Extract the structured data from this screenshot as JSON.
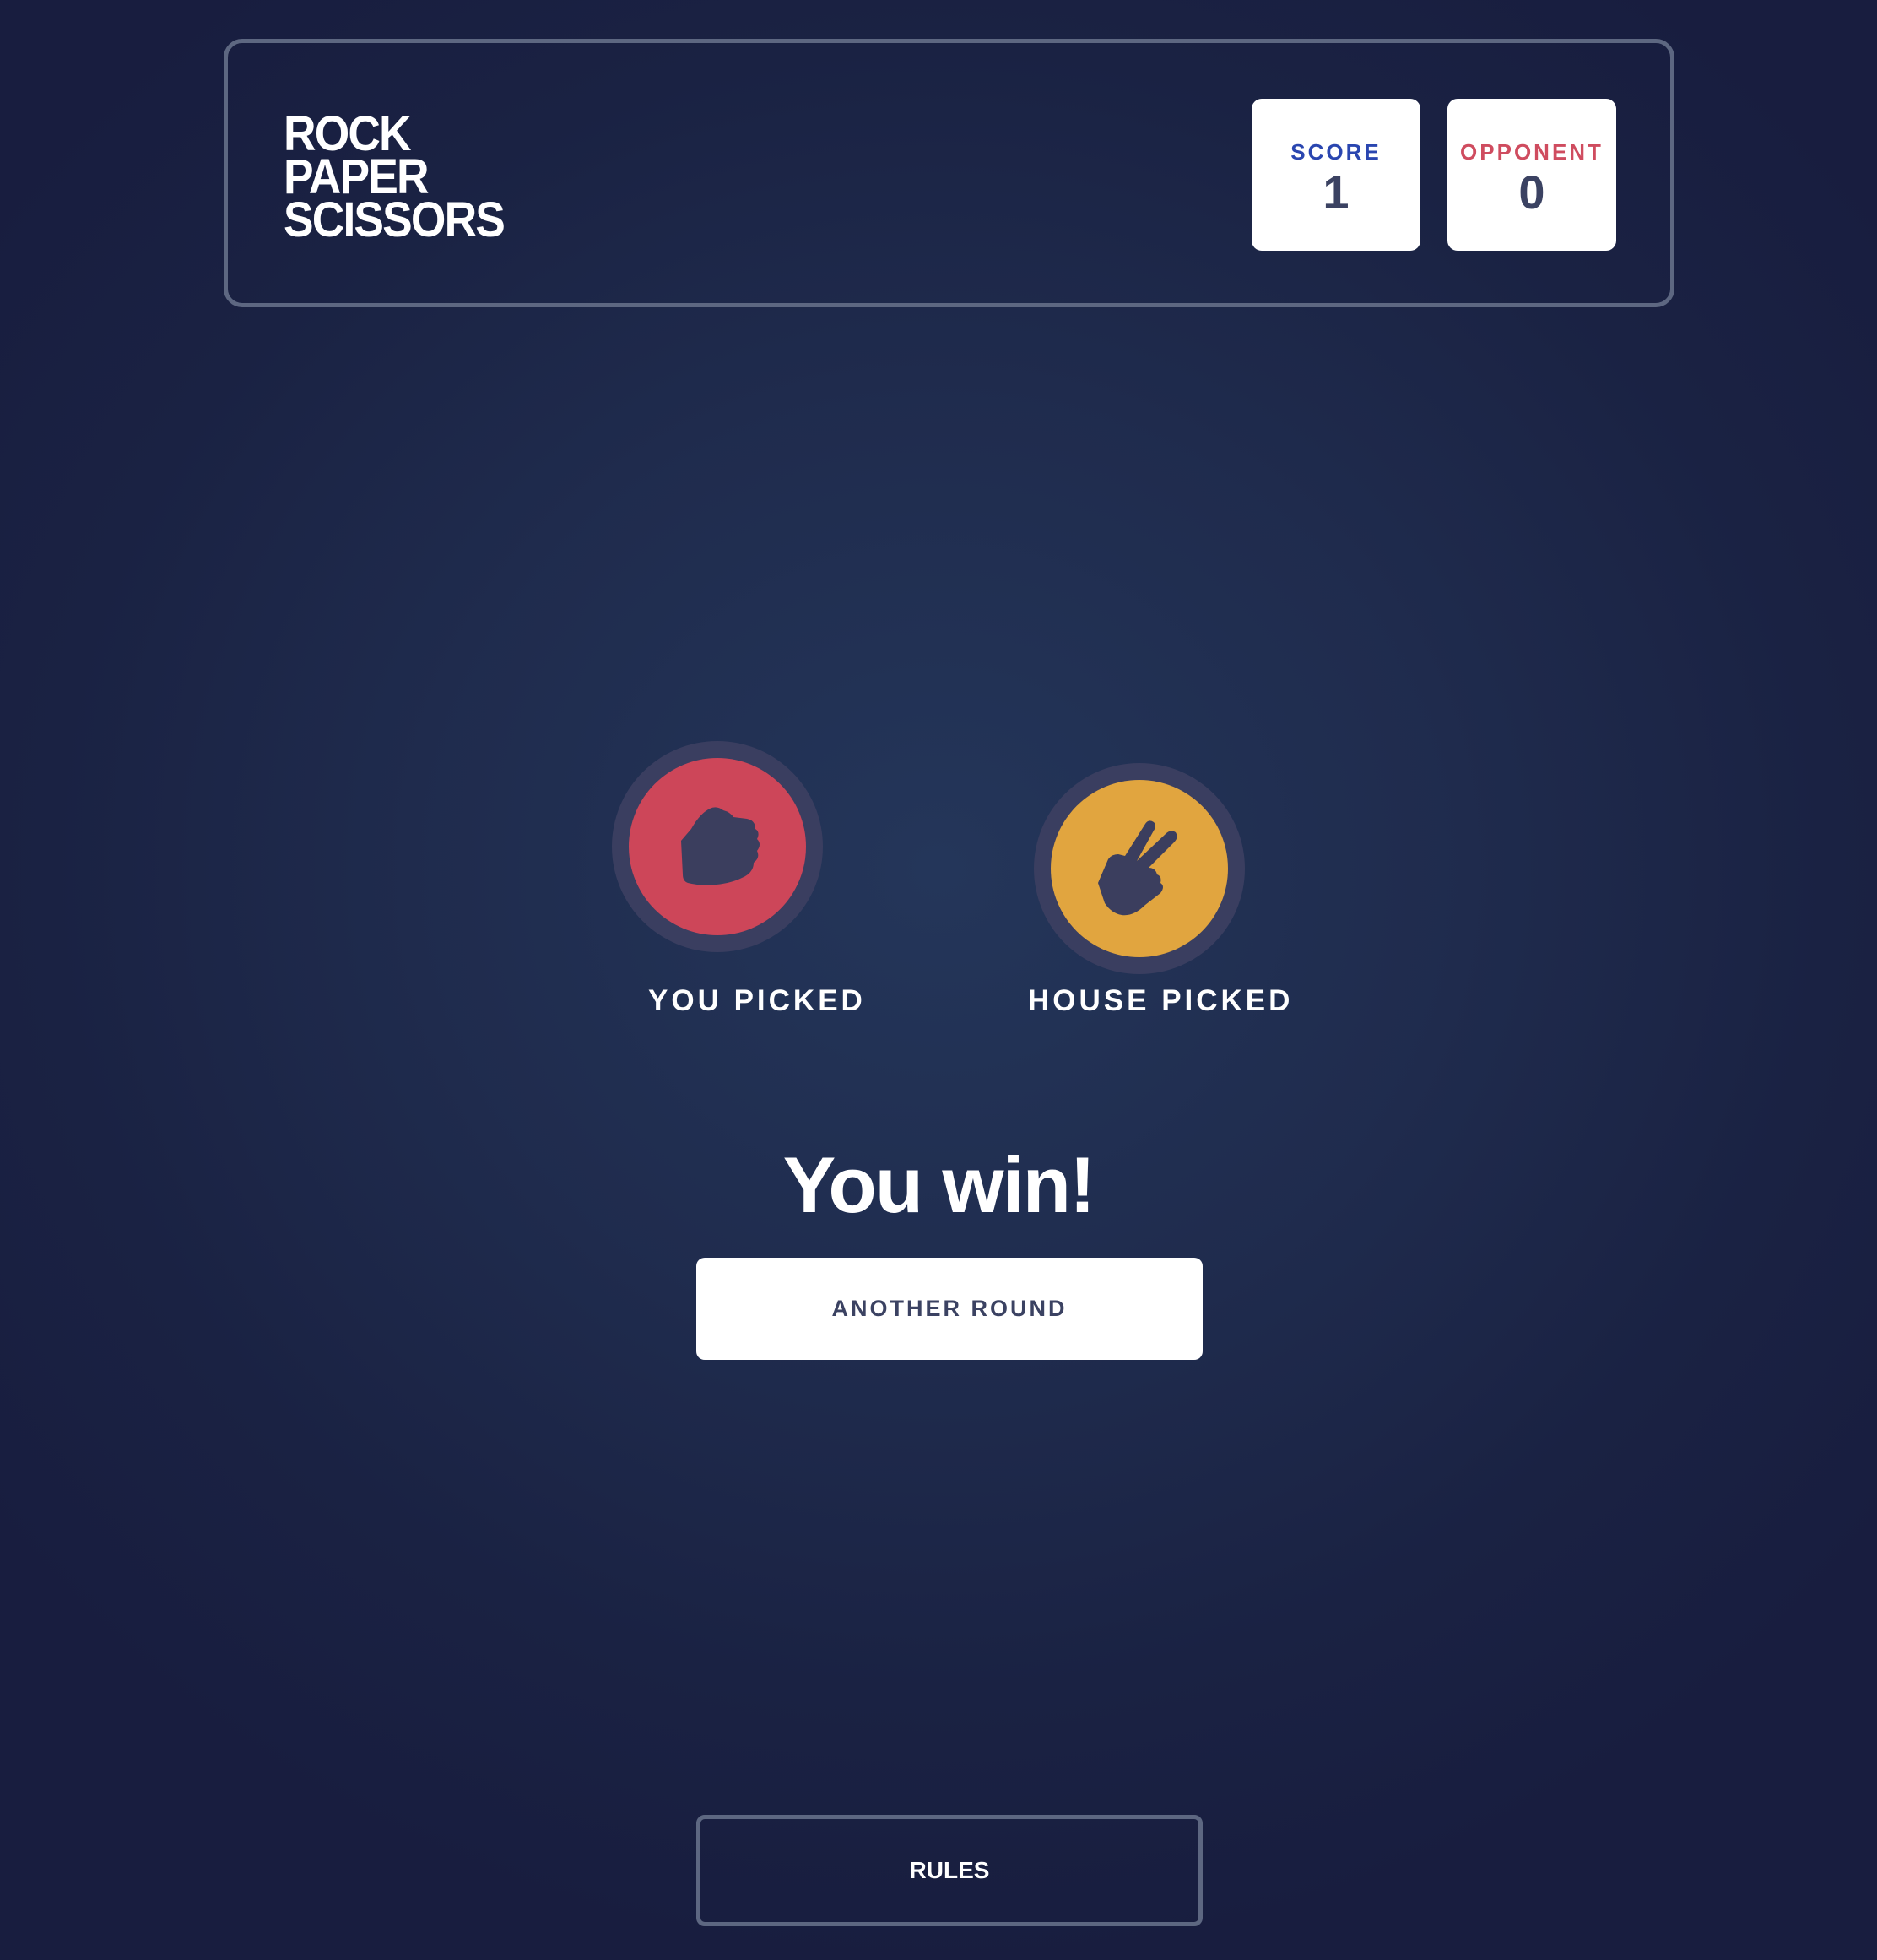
{
  "header": {
    "logo_lines": [
      "Rock",
      "Paper",
      "Scissors"
    ],
    "score": {
      "label": "Score",
      "value": "1"
    },
    "opponent": {
      "label": "Opponent",
      "value": "0"
    }
  },
  "picks": {
    "you": {
      "label": "You picked",
      "choice_icon": "rock-icon"
    },
    "house": {
      "label": "House picked",
      "choice_icon": "scissors-icon"
    }
  },
  "result": {
    "text": "You win!"
  },
  "buttons": {
    "another_round": "Another round",
    "rules": "Rules"
  },
  "colors": {
    "rock": "#cd4659",
    "scissors": "#e1a53f",
    "score_label": "#2a46b0",
    "opponent_label": "#cf4c5f",
    "dark_text": "#3b4262",
    "outline": "#5d6781"
  }
}
